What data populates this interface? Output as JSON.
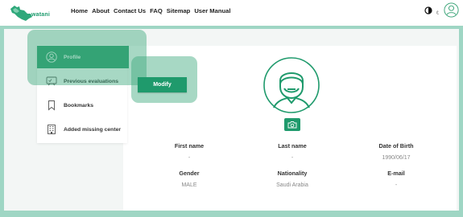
{
  "header": {
    "logo_text": "watani",
    "nav": [
      "Home",
      "About",
      "Contact Us",
      "FAQ",
      "Sitemap",
      "User Manual"
    ],
    "lang_label": "ع",
    "icons": [
      "contrast-icon",
      "user-icon"
    ]
  },
  "sidebar": {
    "items": [
      {
        "label": "Profile",
        "icon": "user-circle-icon",
        "active": true
      },
      {
        "label": "Previous evaluations",
        "icon": "evaluation-icon",
        "active": false
      },
      {
        "label": "Bookmarks",
        "icon": "bookmark-icon",
        "active": false
      },
      {
        "label": "Added missing center",
        "icon": "building-icon",
        "active": false
      }
    ]
  },
  "profile": {
    "modify_label": "Modify",
    "fields": [
      {
        "label": "First name",
        "value": "-"
      },
      {
        "label": "Last name",
        "value": "-"
      },
      {
        "label": "Date of Birth",
        "value": "1990/06/17"
      },
      {
        "label": "Gender",
        "value": "MALE"
      },
      {
        "label": "Nationality",
        "value": "Saudi Arabia"
      },
      {
        "label": "E-mail",
        "value": "-"
      }
    ]
  },
  "colors": {
    "brand": "#1f9a6c",
    "background": "#9fd6c4",
    "highlight": "#3ba87c"
  }
}
